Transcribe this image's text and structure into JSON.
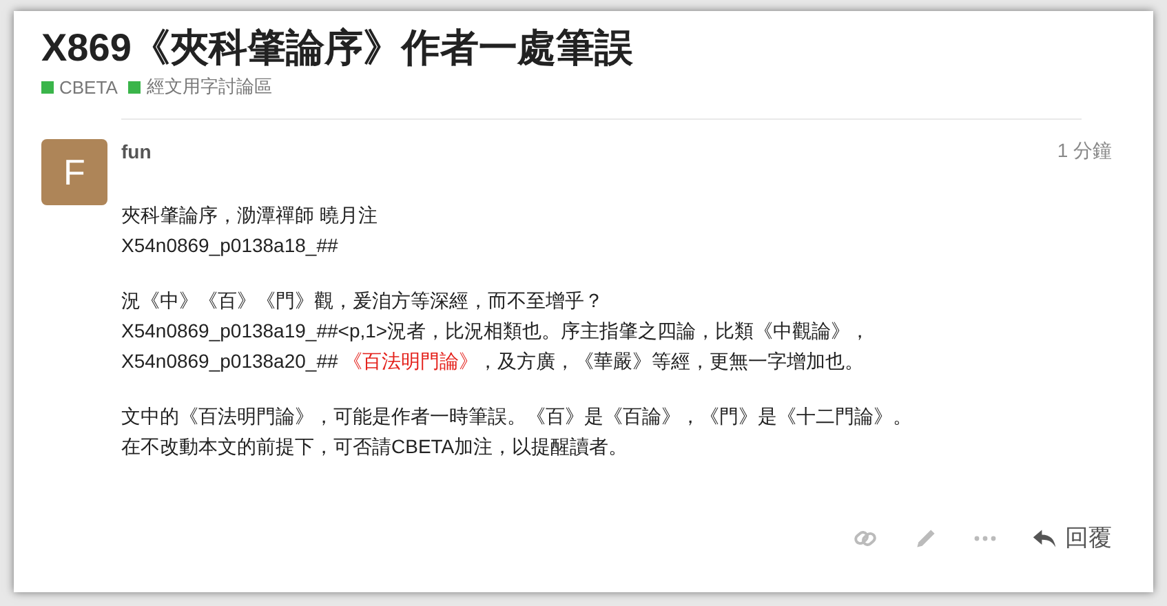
{
  "topic": {
    "title": "X869《夾科肇論序》作者一處筆誤",
    "categories": [
      {
        "name": "CBETA",
        "color": "#3ab54a"
      },
      {
        "name": "經文用字討論區",
        "color": "#3ab54a"
      }
    ]
  },
  "post": {
    "avatar_letter": "F",
    "username": "fun",
    "time": "1 分鐘",
    "paragraphs": [
      [
        [
          {
            "kind": "text",
            "text": "夾科肇論序，泐潭禪師 曉月注"
          }
        ],
        [
          {
            "kind": "text",
            "text": "X54n0869_p0138a18_##"
          }
        ]
      ],
      [
        [
          {
            "kind": "text",
            "text": "況《中》《百》《門》觀，爰洎方等深經，而不至增乎？"
          }
        ],
        [
          {
            "kind": "text",
            "text": "X54n0869_p0138a19_##<p,1>況者，比況相類也。序主指肇之四論，比類《中觀論》，"
          }
        ],
        [
          {
            "kind": "text",
            "text": "X54n0869_p0138a20_## "
          },
          {
            "kind": "link",
            "text": "《百法明門論》"
          },
          {
            "kind": "text",
            "text": "，及方廣，《華嚴》等經，更無一字增加也。"
          }
        ]
      ],
      [
        [
          {
            "kind": "text",
            "text": "文中的《百法明門論》，可能是作者一時筆誤。《百》是《百論》，《門》是《十二門論》。"
          }
        ],
        [
          {
            "kind": "text",
            "text": "在不改動本文的前提下，可否請CBETA加注，以提醒讀者。"
          }
        ]
      ]
    ],
    "actions": {
      "reply": "回覆"
    }
  }
}
